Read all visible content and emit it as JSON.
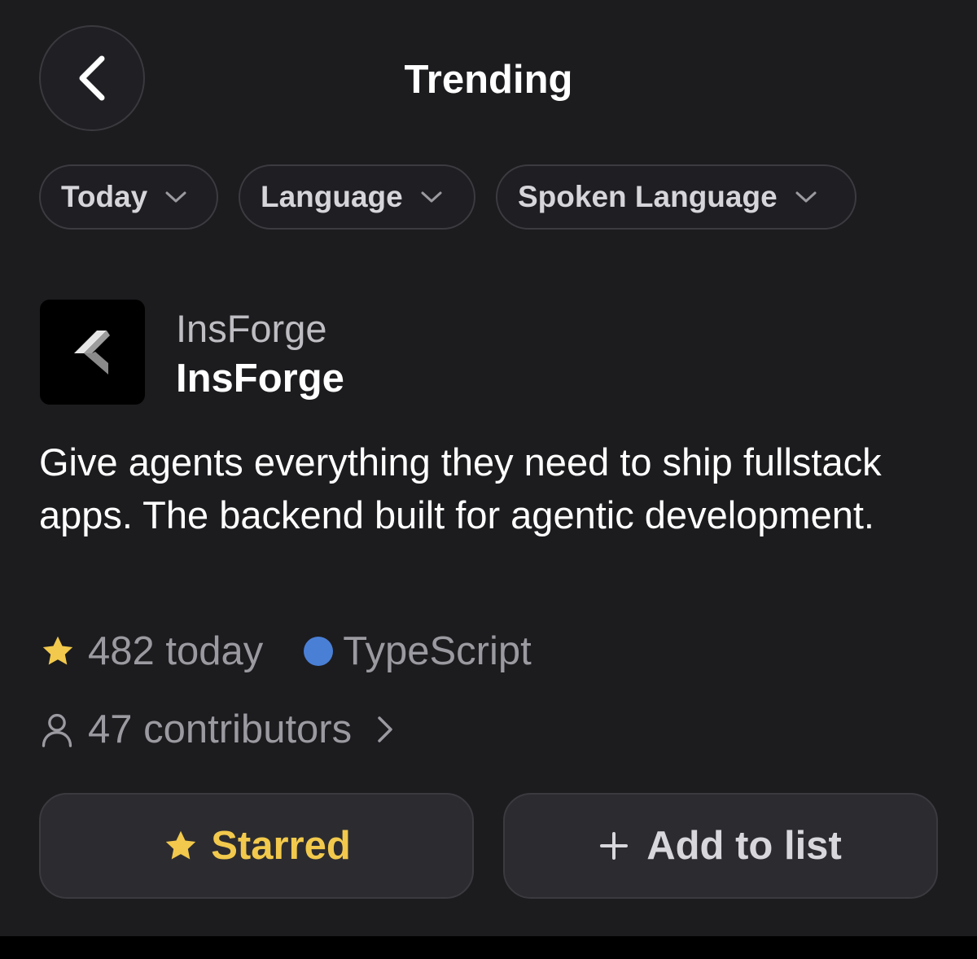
{
  "header": {
    "title": "Trending"
  },
  "filters": [
    {
      "label": "Today"
    },
    {
      "label": "Language"
    },
    {
      "label": "Spoken Language"
    }
  ],
  "repo": {
    "owner": "InsForge",
    "name": "InsForge",
    "description": "Give agents everything they need to ship fullstack apps. The backend built for agentic development.",
    "stars_today": "482 today",
    "language": "TypeScript",
    "language_color": "#4a7fd6",
    "contributors": "47 contributors"
  },
  "actions": {
    "starred_label": "Starred",
    "add_to_list_label": "Add to list"
  },
  "colors": {
    "background": "#1c1c1f",
    "star": "#f2c94c",
    "button_bg": "#2c2c30"
  }
}
